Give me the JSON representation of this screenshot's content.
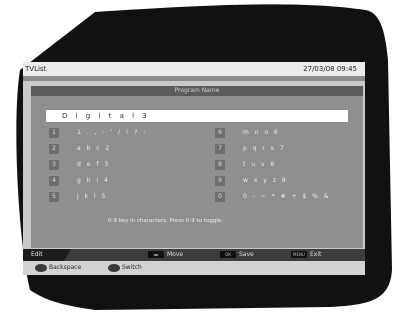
{
  "window": {
    "title": "TVList",
    "datetime": "27/03/08 09:45"
  },
  "panel": {
    "title": "Program Name"
  },
  "edit_field": {
    "value": "D i g i t a l   3"
  },
  "keypad": {
    "left": [
      {
        "num": "1",
        "chars": "1 . , - ' / ! ? :"
      },
      {
        "num": "2",
        "chars": "a b c 2"
      },
      {
        "num": "3",
        "chars": "d e f 3"
      },
      {
        "num": "4",
        "chars": "g h i 4"
      },
      {
        "num": "5",
        "chars": "j k l 5"
      }
    ],
    "right": [
      {
        "num": "6",
        "chars": "m n o 6"
      },
      {
        "num": "7",
        "chars": "p q r s 7"
      },
      {
        "num": "8",
        "chars": "t u v 8"
      },
      {
        "num": "9",
        "chars": "w x y z 9"
      },
      {
        "num": "0",
        "chars": "0 - ~ * # + $ % &"
      }
    ]
  },
  "hint": "0-9 key in characters. Press 0-9 to toggle.",
  "footer": {
    "mode": "Edit",
    "move_label": "Move",
    "save_label": "Save",
    "exit_label": "Exit",
    "move_key": "◄►",
    "save_key": "OK",
    "exit_key": "MENU"
  },
  "color_buttons": {
    "backspace_label": "Backspace",
    "switch_label": "Switch"
  }
}
